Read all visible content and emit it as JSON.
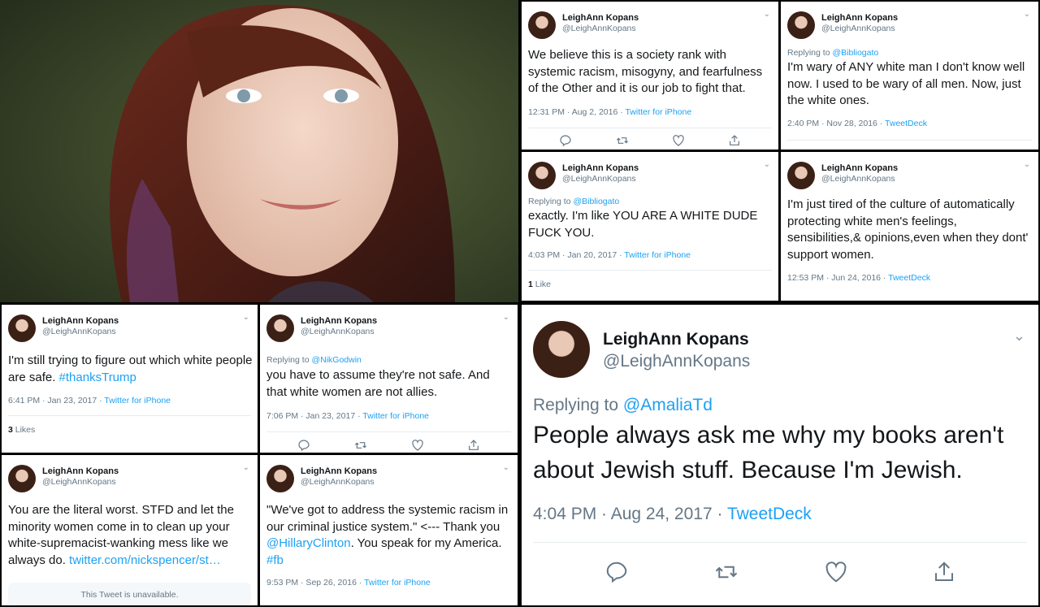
{
  "author": {
    "name": "LeighAnn Kopans",
    "handle": "@LeighAnnKopans"
  },
  "colors": {
    "link": "#1da1f2",
    "text": "#14171a",
    "muted": "#657786",
    "divider": "#e6ecf0"
  },
  "icons": [
    "reply-icon",
    "retweet-icon",
    "like-icon",
    "share-icon",
    "chevron-down-icon",
    "avatar-photo"
  ],
  "tweets": [
    {
      "id": "t1",
      "text": "We believe this is a society rank with systemic racism, misogyny, and fearfulness of the Other and it is our job to fight that.",
      "time": "12:31 PM · Aug 2, 2016 · ",
      "source": "Twitter for iPhone"
    },
    {
      "id": "t2",
      "reply_prefix": "Replying to ",
      "reply_to": "@Bibliogato",
      "text": "I'm wary of ANY white man I don't know well now. I used to be wary of all men. Now, just the white ones.",
      "time": "2:40 PM · Nov 28, 2016 · ",
      "source": "TweetDeck"
    },
    {
      "id": "t3",
      "reply_prefix": "Replying to ",
      "reply_to": "@Bibliogato",
      "text": "exactly. I'm like YOU ARE A WHITE DUDE FUCK YOU.",
      "time": "4:03 PM · Jan 20, 2017 · ",
      "source": "Twitter for iPhone",
      "likes_count": "1",
      "likes_label": " Like"
    },
    {
      "id": "t4",
      "text": "I'm just tired of the culture of automatically protecting white men's feelings, sensibilities,& opinions,even when they dont' support women.",
      "time": "12:53 PM · Jun 24, 2016 · ",
      "source": "TweetDeck"
    },
    {
      "id": "t5",
      "text": "I'm still trying to figure out which white people are safe. ",
      "hashtag": "#thanksTrump",
      "time": "6:41 PM · Jan 23, 2017 · ",
      "source": "Twitter for iPhone",
      "likes_count": "3",
      "likes_label": " Likes"
    },
    {
      "id": "t6",
      "reply_prefix": "Replying to ",
      "reply_to": "@NikGodwin",
      "text": "you have to assume they're not safe. And that white women are not allies.",
      "time": "7:06 PM · Jan 23, 2017 · ",
      "source": "Twitter for iPhone"
    },
    {
      "id": "t7",
      "text": "You are the literal worst. STFD and let the minority women come in to clean up your white-supremacist-wanking mess like we always do. ",
      "link": "twitter.com/nickspencer/st…",
      "unavailable": "This Tweet is unavailable."
    },
    {
      "id": "t8",
      "text_a": "\"We've got to address the systemic racism in our criminal justice system.\" <--- Thank you ",
      "mention": "@HillaryClinton",
      "text_b": ". You speak for my America. ",
      "hashtag": "#fb",
      "time": "9:53 PM · Sep 26, 2016 · ",
      "source": "Twitter for iPhone"
    },
    {
      "id": "t9",
      "reply_prefix": "Replying to ",
      "reply_to": "@AmaliaTd",
      "text": "People always ask me why my books aren't about Jewish stuff. Because I'm Jewish.",
      "time": "4:04 PM · Aug 24, 2017 · ",
      "source": "TweetDeck"
    }
  ]
}
